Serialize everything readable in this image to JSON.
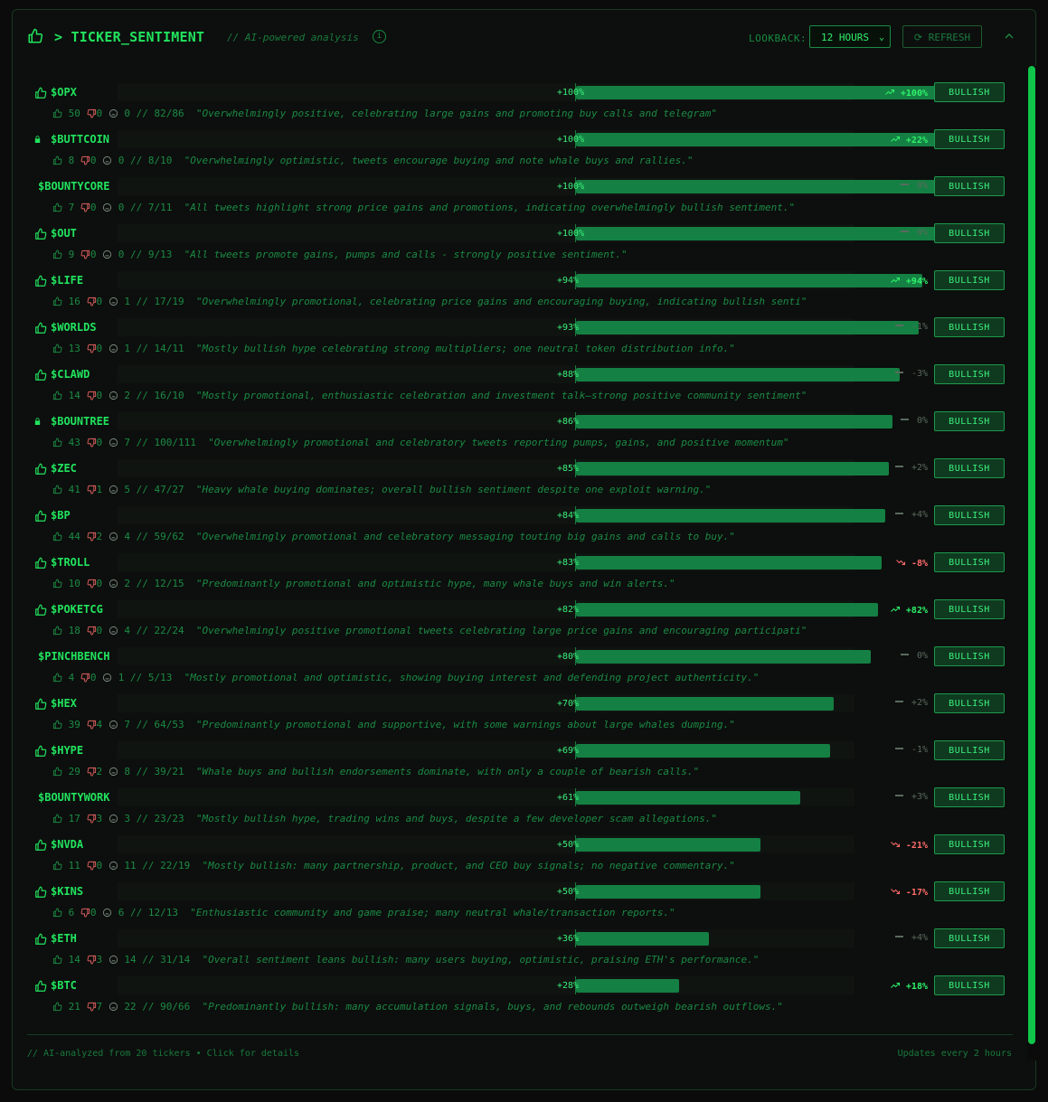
{
  "header": {
    "title": "> TICKER_SENTIMENT",
    "subtitle": "// AI-powered analysis",
    "info_icon": "i",
    "lookback_label": "LOOKBACK:",
    "lookback_value": "12 HOURS",
    "refresh_label": "REFRESH"
  },
  "tickers": [
    {
      "name": "$OPX",
      "icon": "thumb",
      "pct": "+100%",
      "value": 100,
      "chg": "+100%",
      "dir": "up",
      "badge": "BULLISH",
      "up": "50",
      "down": "0",
      "neutral": "0",
      "ratio": "// 82/86",
      "summary": "\"Overwhelmingly positive, celebrating large gains and promoting buy calls and telegram\""
    },
    {
      "name": "$BUTTCOIN",
      "icon": "lock",
      "pct": "+100%",
      "value": 100,
      "chg": "+22%",
      "dir": "up",
      "badge": "BULLISH",
      "up": "8",
      "down": "0",
      "neutral": "0",
      "ratio": "// 8/10",
      "summary": "\"Overwhelmingly optimistic, tweets encourage buying and note whale buys and rallies.\""
    },
    {
      "name": "$BOUNTYCORE",
      "icon": "none",
      "pct": "+100%",
      "value": 100,
      "chg": "0%",
      "dir": "flat",
      "badge": "BULLISH",
      "up": "7",
      "down": "0",
      "neutral": "0",
      "ratio": "// 7/11",
      "summary": "\"All tweets highlight strong price gains and promotions, indicating overwhelmingly bullish sentiment.\""
    },
    {
      "name": "$OUT",
      "icon": "thumb",
      "pct": "+100%",
      "value": 100,
      "chg": "0%",
      "dir": "flat",
      "badge": "BULLISH",
      "up": "9",
      "down": "0",
      "neutral": "0",
      "ratio": "// 9/13",
      "summary": "\"All tweets promote gains, pumps and calls - strongly positive sentiment.\""
    },
    {
      "name": "$LIFE",
      "icon": "thumb",
      "pct": "+94%",
      "value": 94,
      "chg": "+94%",
      "dir": "up",
      "badge": "BULLISH",
      "up": "16",
      "down": "0",
      "neutral": "1",
      "ratio": "// 17/19",
      "summary": "\"Overwhelmingly promotional, celebrating price gains and encouraging buying, indicating bullish senti\""
    },
    {
      "name": "$WORLDS",
      "icon": "thumb",
      "pct": "+93%",
      "value": 93,
      "chg": "-1%",
      "dir": "flat",
      "badge": "BULLISH",
      "up": "13",
      "down": "0",
      "neutral": "1",
      "ratio": "// 14/11",
      "summary": "\"Mostly bullish hype celebrating strong multipliers; one neutral token distribution info.\""
    },
    {
      "name": "$CLAWD",
      "icon": "thumb",
      "pct": "+88%",
      "value": 88,
      "chg": "-3%",
      "dir": "flat",
      "badge": "BULLISH",
      "up": "14",
      "down": "0",
      "neutral": "2",
      "ratio": "// 16/10",
      "summary": "\"Mostly promotional, enthusiastic celebration and investment talk—strong positive community sentiment\""
    },
    {
      "name": "$BOUNTREE",
      "icon": "lock",
      "pct": "+86%",
      "value": 86,
      "chg": "0%",
      "dir": "flat",
      "badge": "BULLISH",
      "up": "43",
      "down": "0",
      "neutral": "7",
      "ratio": "// 100/111",
      "summary": "\"Overwhelmingly promotional and celebratory tweets reporting pumps, gains, and positive momentum\""
    },
    {
      "name": "$ZEC",
      "icon": "thumb",
      "pct": "+85%",
      "value": 85,
      "chg": "+2%",
      "dir": "flat",
      "badge": "BULLISH",
      "up": "41",
      "down": "1",
      "neutral": "5",
      "ratio": "// 47/27",
      "summary": "\"Heavy whale buying dominates; overall bullish sentiment despite one exploit warning.\""
    },
    {
      "name": "$BP",
      "icon": "thumb",
      "pct": "+84%",
      "value": 84,
      "chg": "+4%",
      "dir": "flat",
      "badge": "BULLISH",
      "up": "44",
      "down": "2",
      "neutral": "4",
      "ratio": "// 59/62",
      "summary": "\"Overwhelmingly promotional and celebratory messaging touting big gains and calls to buy.\""
    },
    {
      "name": "$TROLL",
      "icon": "thumb",
      "pct": "+83%",
      "value": 83,
      "chg": "-8%",
      "dir": "down",
      "badge": "BULLISH",
      "up": "10",
      "down": "0",
      "neutral": "2",
      "ratio": "// 12/15",
      "summary": "\"Predominantly promotional and optimistic hype, many whale buys and win alerts.\""
    },
    {
      "name": "$POKETCG",
      "icon": "thumb",
      "pct": "+82%",
      "value": 82,
      "chg": "+82%",
      "dir": "up",
      "badge": "BULLISH",
      "up": "18",
      "down": "0",
      "neutral": "4",
      "ratio": "// 22/24",
      "summary": "\"Overwhelmingly positive promotional tweets celebrating large price gains and encouraging participati\""
    },
    {
      "name": "$PINCHBENCH",
      "icon": "none",
      "pct": "+80%",
      "value": 80,
      "chg": "0%",
      "dir": "flat",
      "badge": "BULLISH",
      "up": "4",
      "down": "0",
      "neutral": "1",
      "ratio": "// 5/13",
      "summary": "\"Mostly promotional and optimistic, showing buying interest and defending project authenticity.\""
    },
    {
      "name": "$HEX",
      "icon": "thumb",
      "pct": "+70%",
      "value": 70,
      "chg": "+2%",
      "dir": "flat",
      "badge": "BULLISH",
      "up": "39",
      "down": "4",
      "neutral": "7",
      "ratio": "// 64/53",
      "summary": "\"Predominantly promotional and supportive, with some warnings about large whales dumping.\""
    },
    {
      "name": "$HYPE",
      "icon": "thumb",
      "pct": "+69%",
      "value": 69,
      "chg": "-1%",
      "dir": "flat",
      "badge": "BULLISH",
      "up": "29",
      "down": "2",
      "neutral": "8",
      "ratio": "// 39/21",
      "summary": "\"Whale buys and bullish endorsements dominate, with only a couple of bearish calls.\""
    },
    {
      "name": "$BOUNTYWORK",
      "icon": "none",
      "pct": "+61%",
      "value": 61,
      "chg": "+3%",
      "dir": "flat",
      "badge": "BULLISH",
      "up": "17",
      "down": "3",
      "neutral": "3",
      "ratio": "// 23/23",
      "summary": "\"Mostly bullish hype, trading wins and buys, despite a few developer scam allegations.\""
    },
    {
      "name": "$NVDA",
      "icon": "thumb",
      "pct": "+50%",
      "value": 50,
      "chg": "-21%",
      "dir": "down",
      "badge": "BULLISH",
      "up": "11",
      "down": "0",
      "neutral": "11",
      "ratio": "// 22/19",
      "summary": "\"Mostly bullish: many partnership, product, and CEO buy signals; no negative commentary.\""
    },
    {
      "name": "$KINS",
      "icon": "thumb",
      "pct": "+50%",
      "value": 50,
      "chg": "-17%",
      "dir": "down",
      "badge": "BULLISH",
      "up": "6",
      "down": "0",
      "neutral": "6",
      "ratio": "// 12/13",
      "summary": "\"Enthusiastic community and game praise; many neutral whale/transaction reports.\""
    },
    {
      "name": "$ETH",
      "icon": "thumb",
      "pct": "+36%",
      "value": 36,
      "chg": "+4%",
      "dir": "flat",
      "badge": "BULLISH",
      "up": "14",
      "down": "3",
      "neutral": "14",
      "ratio": "// 31/14",
      "summary": "\"Overall sentiment leans bullish: many users buying, optimistic, praising ETH's performance.\""
    },
    {
      "name": "$BTC",
      "icon": "thumb",
      "pct": "+28%",
      "value": 28,
      "chg": "+18%",
      "dir": "up",
      "badge": "BULLISH",
      "up": "21",
      "down": "7",
      "neutral": "22",
      "ratio": "// 90/66",
      "summary": "\"Predominantly bullish: many accumulation signals, buys, and rebounds outweigh bearish outflows.\""
    }
  ],
  "footer": {
    "left": "// AI-analyzed from 20 tickers • Click for details",
    "right": "Updates every 2 hours"
  },
  "colors": {
    "accent": "#22e35e",
    "bar": "#158043",
    "down": "#ff6b6b",
    "flat": "#5a6a5e"
  }
}
